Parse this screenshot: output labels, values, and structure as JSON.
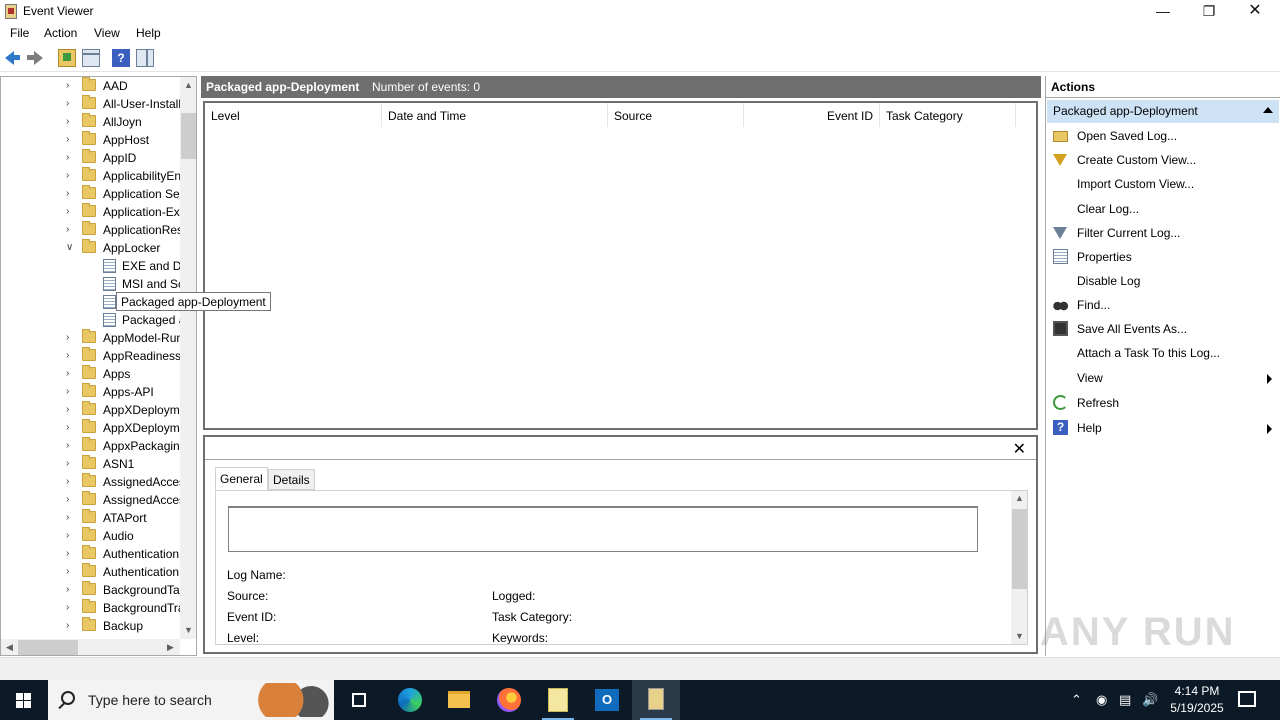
{
  "window": {
    "title": "Event Viewer"
  },
  "menu": [
    "File",
    "Action",
    "View",
    "Help"
  ],
  "tree": {
    "items": [
      {
        "label": "AAD",
        "level": 0,
        "expanded": false
      },
      {
        "label": "All-User-Install",
        "level": 0,
        "expanded": false
      },
      {
        "label": "AllJoyn",
        "level": 0,
        "expanded": false
      },
      {
        "label": "AppHost",
        "level": 0,
        "expanded": false
      },
      {
        "label": "AppID",
        "level": 0,
        "expanded": false
      },
      {
        "label": "ApplicabilityEngine",
        "level": 0,
        "expanded": false
      },
      {
        "label": "Application Server-Applications",
        "level": 0,
        "expanded": false
      },
      {
        "label": "Application-Experience",
        "level": 0,
        "expanded": false
      },
      {
        "label": "ApplicationResourceManagementSystem",
        "level": 0,
        "expanded": false
      },
      {
        "label": "AppLocker",
        "level": 0,
        "expanded": true
      },
      {
        "label": "EXE and DLL",
        "level": 1
      },
      {
        "label": "MSI and Script",
        "level": 1
      },
      {
        "label": "Packaged app-Deployment",
        "level": 1,
        "selected": true
      },
      {
        "label": "Packaged app-Execution",
        "level": 1
      },
      {
        "label": "AppModel-Runtime",
        "level": 0,
        "expanded": false
      },
      {
        "label": "AppReadiness",
        "level": 0,
        "expanded": false
      },
      {
        "label": "Apps",
        "level": 0,
        "expanded": false
      },
      {
        "label": "Apps-API",
        "level": 0,
        "expanded": false
      },
      {
        "label": "AppXDeployment",
        "level": 0,
        "expanded": false
      },
      {
        "label": "AppXDeployment-Server",
        "level": 0,
        "expanded": false
      },
      {
        "label": "AppxPackagingOM",
        "level": 0,
        "expanded": false
      },
      {
        "label": "ASN1",
        "level": 0,
        "expanded": false
      },
      {
        "label": "AssignedAccess",
        "level": 0,
        "expanded": false
      },
      {
        "label": "AssignedAccessBroker",
        "level": 0,
        "expanded": false
      },
      {
        "label": "ATAPort",
        "level": 0,
        "expanded": false
      },
      {
        "label": "Audio",
        "level": 0,
        "expanded": false
      },
      {
        "label": "Authentication",
        "level": 0,
        "expanded": false
      },
      {
        "label": "Authentication User Interface",
        "level": 0,
        "expanded": false
      },
      {
        "label": "BackgroundTaskInfrastructure",
        "level": 0,
        "expanded": false
      },
      {
        "label": "BackgroundTransfer-ContentPrefetcher",
        "level": 0,
        "expanded": false
      },
      {
        "label": "Backup",
        "level": 0,
        "expanded": false
      }
    ],
    "tooltip": "Packaged app-Deployment"
  },
  "center": {
    "log_title": "Packaged app-Deployment",
    "event_count": "Number of events: 0",
    "columns": [
      "Level",
      "Date and Time",
      "Source",
      "Event ID",
      "Task Category"
    ]
  },
  "details": {
    "tabs": [
      "General",
      "Details"
    ],
    "active_tab": "General",
    "fields": {
      "log_name": "Log Name:",
      "source": "Source:",
      "event_id": "Event ID:",
      "level": "Level:",
      "logged": "Logged:",
      "task_category": "Task Category:",
      "keywords": "Keywords:"
    }
  },
  "actions": {
    "title": "Actions",
    "section": "Packaged app-Deployment",
    "items": [
      {
        "label": "Open Saved Log...",
        "icon": "open-folder-icon"
      },
      {
        "label": "Create Custom View...",
        "icon": "filter-star-icon"
      },
      {
        "label": "Import Custom View...",
        "icon": ""
      },
      {
        "label": "Clear Log...",
        "icon": ""
      },
      {
        "label": "Filter Current Log...",
        "icon": "filter-icon"
      },
      {
        "label": "Properties",
        "icon": "properties-icon"
      },
      {
        "label": "Disable Log",
        "icon": ""
      },
      {
        "label": "Find...",
        "icon": "binoculars-icon"
      },
      {
        "label": "Save All Events As...",
        "icon": "save-icon"
      },
      {
        "label": "Attach a Task To this Log...",
        "icon": ""
      },
      {
        "label": "View",
        "icon": "",
        "submenu": true
      },
      {
        "label": "Refresh",
        "icon": "refresh-icon"
      },
      {
        "label": "Help",
        "icon": "help-icon",
        "submenu": true
      }
    ]
  },
  "taskbar": {
    "search_placeholder": "Type here to search",
    "time": "4:14 PM",
    "date": "5/19/2025"
  },
  "watermark": "ANY RUN",
  "colors": {
    "header_gray": "#6e6e6e",
    "selection_blue": "#cde3f5",
    "taskbar": "#0c1a27"
  }
}
